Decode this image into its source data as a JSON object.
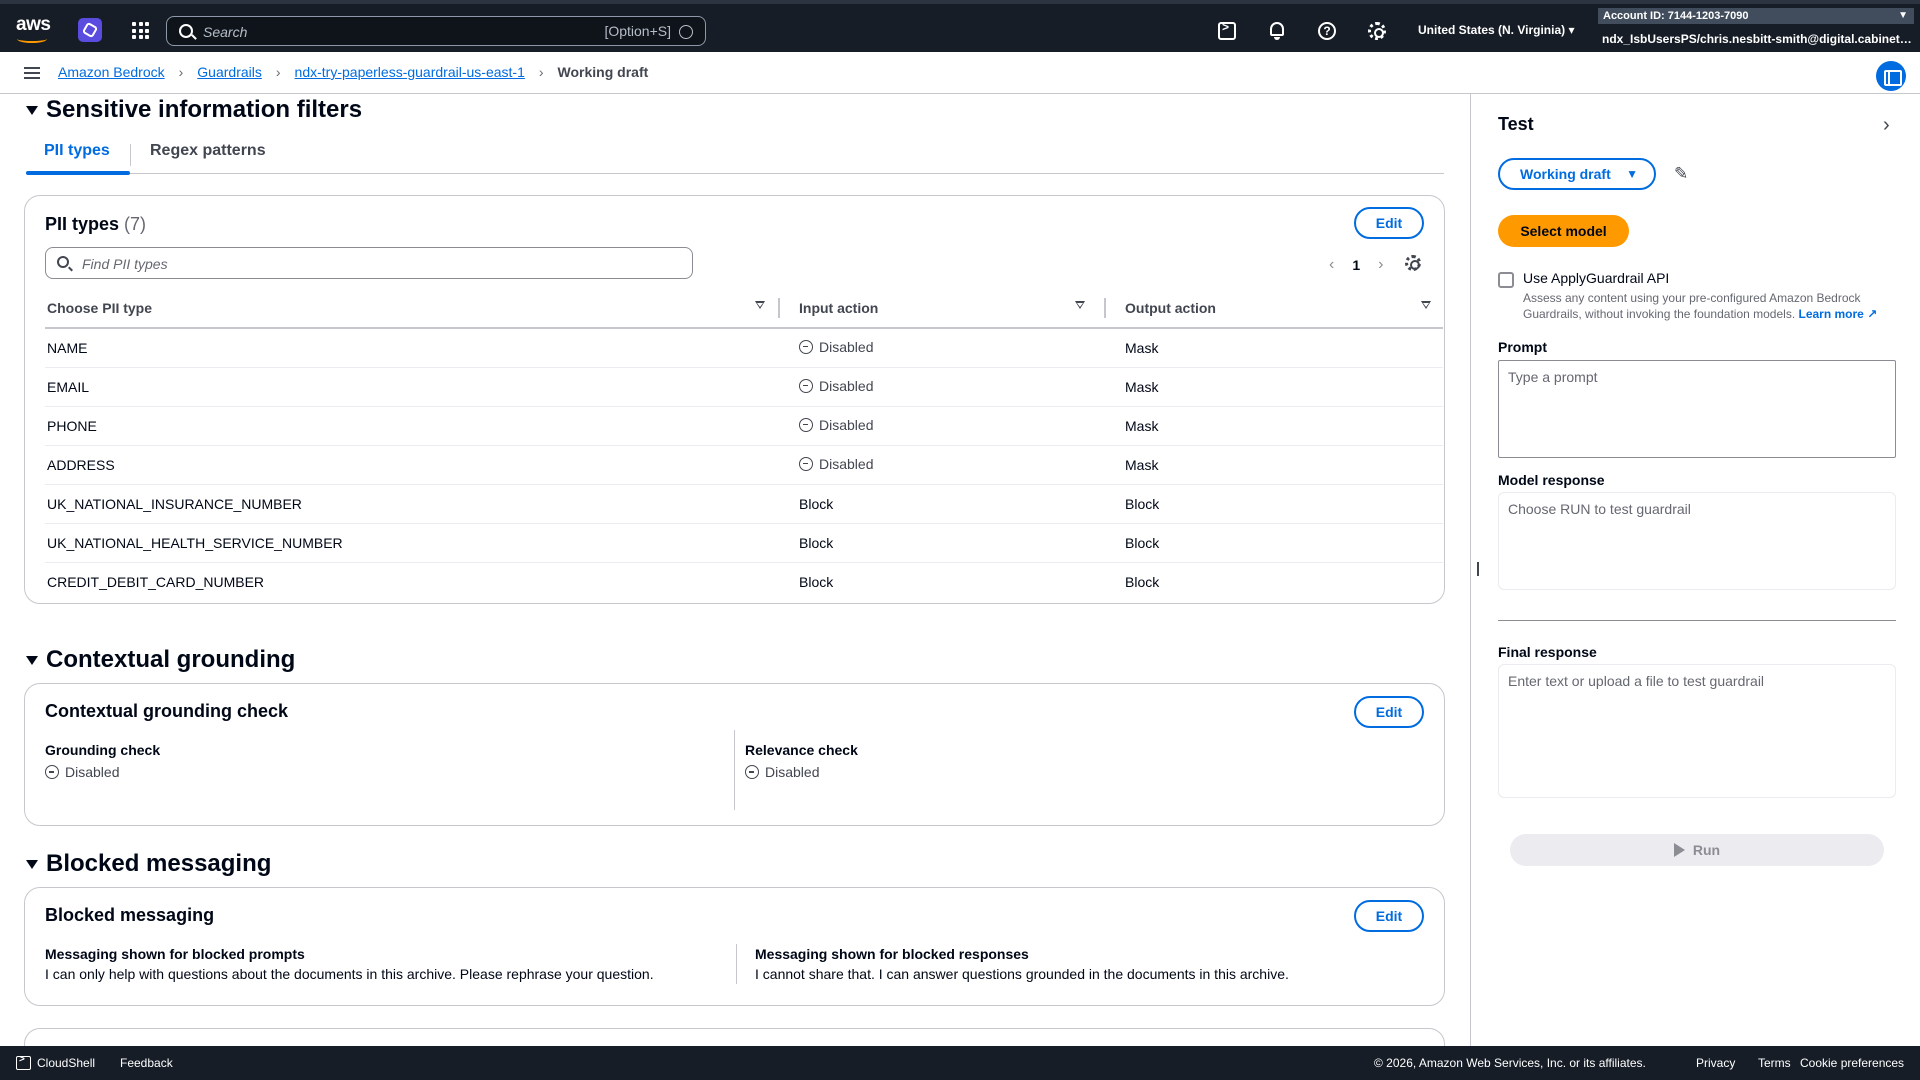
{
  "topnav": {
    "logo_text": "aws",
    "search_placeholder": "Search",
    "search_shortcut": "[Option+S]",
    "region": "United States (N. Virginia)",
    "account_id": "Account ID: 7144-1203-7090",
    "user": "ndx_IsbUsersPS/chris.nesbitt-smith@digital.cabinet-office.gov.uk"
  },
  "breadcrumb": {
    "items": [
      "Amazon Bedrock",
      "Guardrails",
      "ndx-try-paperless-guardrail-us-east-1"
    ],
    "current": "Working draft"
  },
  "sensitive": {
    "heading": "Sensitive information filters",
    "tabs": [
      "PII types",
      "Regex patterns"
    ],
    "card_title": "PII types",
    "count": "(7)",
    "edit": "Edit",
    "find_placeholder": "Find PII types",
    "page": "1",
    "columns": [
      "Choose PII type",
      "Input action",
      "Output action"
    ],
    "rows": [
      {
        "type": "NAME",
        "input": "Disabled",
        "output": "Mask"
      },
      {
        "type": "EMAIL",
        "input": "Disabled",
        "output": "Mask"
      },
      {
        "type": "PHONE",
        "input": "Disabled",
        "output": "Mask"
      },
      {
        "type": "ADDRESS",
        "input": "Disabled",
        "output": "Mask"
      },
      {
        "type": "UK_NATIONAL_INSURANCE_NUMBER",
        "input": "Block",
        "output": "Block"
      },
      {
        "type": "UK_NATIONAL_HEALTH_SERVICE_NUMBER",
        "input": "Block",
        "output": "Block"
      },
      {
        "type": "CREDIT_DEBIT_CARD_NUMBER",
        "input": "Block",
        "output": "Block"
      }
    ]
  },
  "grounding": {
    "heading": "Contextual grounding",
    "card_title": "Contextual grounding check",
    "edit": "Edit",
    "grounding_label": "Grounding check",
    "grounding_value": "Disabled",
    "relevance_label": "Relevance check",
    "relevance_value": "Disabled"
  },
  "blocked": {
    "heading": "Blocked messaging",
    "card_title": "Blocked messaging",
    "edit": "Edit",
    "prompts_label": "Messaging shown for blocked prompts",
    "prompts_value": "I can only help with questions about the documents in this archive. Please rephrase your question.",
    "responses_label": "Messaging shown for blocked responses",
    "responses_value": "I cannot share that. I can answer questions grounded in the documents in this archive."
  },
  "test_panel": {
    "title": "Test",
    "version": "Working draft",
    "select_model": "Select model",
    "checkbox_label": "Use ApplyGuardrail API",
    "checkbox_desc": "Assess any content using your pre-configured Amazon Bedrock Guardrails, without invoking the foundation models.",
    "learn_more": "Learn more",
    "prompt_label": "Prompt",
    "prompt_placeholder": "Type a prompt",
    "model_response_label": "Model response",
    "model_response_placeholder": "Choose RUN to test guardrail",
    "final_response_label": "Final response",
    "final_response_placeholder": "Enter text or upload a file to test guardrail",
    "run": "Run"
  },
  "footer": {
    "cloudshell": "CloudShell",
    "feedback": "Feedback",
    "copyright": "© 2026, Amazon Web Services, Inc. or its affiliates.",
    "privacy": "Privacy",
    "terms": "Terms",
    "cookies": "Cookie preferences"
  },
  "colors": {
    "nav_bg": "#161d26",
    "accent": "#006ce0",
    "primary_button": "#ff9900"
  }
}
